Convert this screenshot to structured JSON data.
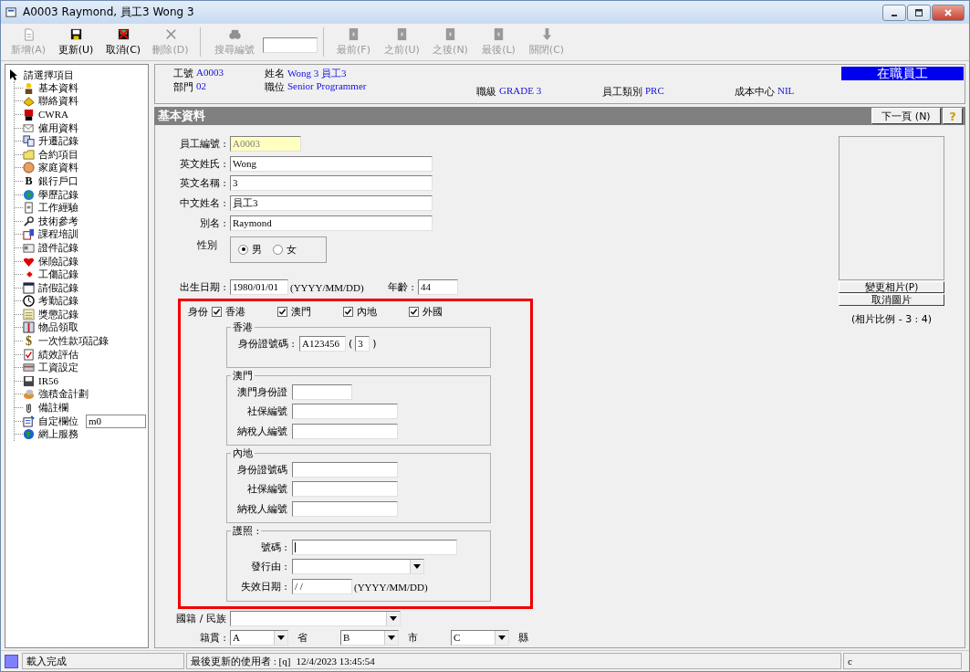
{
  "window": {
    "title": "A0003 Raymond, 員工3 Wong 3"
  },
  "toolbar": [
    {
      "label": "新增(A)",
      "kind": "new",
      "disabled": true
    },
    {
      "label": "更新(U)",
      "kind": "save",
      "disabled": false
    },
    {
      "label": "取消(C)",
      "kind": "cancel",
      "disabled": false
    },
    {
      "label": "刪除(D)",
      "kind": "delete",
      "disabled": true
    },
    {
      "label": "搜尋編號",
      "kind": "search",
      "disabled": true
    },
    {
      "label": "最前(F)",
      "kind": "nav",
      "disabled": true
    },
    {
      "label": "之前(U)",
      "kind": "nav",
      "disabled": true
    },
    {
      "label": "之後(N)",
      "kind": "nav",
      "disabled": true
    },
    {
      "label": "最後(L)",
      "kind": "nav",
      "disabled": true
    },
    {
      "label": "關閉(C)",
      "kind": "close",
      "disabled": true
    }
  ],
  "tree": {
    "root": "請選擇項目",
    "items": [
      {
        "label": "基本資料"
      },
      {
        "label": "聯絡資料"
      },
      {
        "label": "CWRA"
      },
      {
        "label": "僱用資料"
      },
      {
        "label": "升遷記錄"
      },
      {
        "label": "合約項目"
      },
      {
        "label": "家庭資料"
      },
      {
        "label": "銀行戶口",
        "icon_text": "B"
      },
      {
        "label": "學歷記錄"
      },
      {
        "label": "工作經驗"
      },
      {
        "label": "技術參考"
      },
      {
        "label": "課程培訓"
      },
      {
        "label": "證件記錄"
      },
      {
        "label": "保險記錄"
      },
      {
        "label": "工傷記錄"
      },
      {
        "label": "請假記錄"
      },
      {
        "label": "考勤記錄"
      },
      {
        "label": "獎懲記錄"
      },
      {
        "label": "物品領取"
      },
      {
        "label": "一次性款項記錄",
        "icon_text": "$"
      },
      {
        "label": "績效評估"
      },
      {
        "label": "工資設定"
      },
      {
        "label": "IR56"
      },
      {
        "label": "強積金計劃"
      },
      {
        "label": "備註欄"
      },
      {
        "label": "自定欄位",
        "field": "m0"
      },
      {
        "label": "網上服務"
      }
    ]
  },
  "header": {
    "rows": [
      [
        {
          "label": "工號",
          "value": "A0003"
        },
        {
          "label": "姓名",
          "value": "Wong 3 員工3"
        }
      ],
      [
        {
          "label": "部門",
          "value": "02"
        },
        {
          "label": "職位",
          "value": "Senior Programmer"
        },
        {
          "label": "職級",
          "value": "GRADE 3"
        },
        {
          "label": "員工類別",
          "value": "PRC"
        },
        {
          "label": "成本中心",
          "value": "NIL"
        }
      ]
    ],
    "status": "在職員工"
  },
  "section": {
    "title": "基本資料",
    "next": "下一頁 (N)",
    "help": "?"
  },
  "form": {
    "fields": [
      {
        "label": "員工編號 :",
        "value": "A0003",
        "kind": "readonly"
      },
      {
        "label": "英文姓氏 :",
        "value": "Wong",
        "kind": "text"
      },
      {
        "label": "英文名稱 :",
        "value": "3",
        "kind": "text"
      },
      {
        "label": "中文姓名 :",
        "value": "員工3",
        "kind": "text"
      },
      {
        "label": "別名 :",
        "value": "Raymond",
        "kind": "text"
      }
    ],
    "gender": {
      "label": "性別",
      "options": [
        {
          "label": "男",
          "selected": true
        },
        {
          "label": "女",
          "selected": false
        }
      ]
    },
    "birth": {
      "label": "出生日期 :",
      "value": "1980/01/01",
      "hint": "(YYYY/MM/DD)",
      "age_label": "年齡 :",
      "age": "44"
    },
    "highlighted": true,
    "identity": {
      "label": "身份",
      "options": [
        {
          "label": "香港",
          "checked": true
        },
        {
          "label": "澳門",
          "checked": true
        },
        {
          "label": "內地",
          "checked": true
        },
        {
          "label": "外國",
          "checked": true
        }
      ]
    },
    "groups": [
      {
        "title": "香港",
        "rows": [
          {
            "label": "身份證號碼 :",
            "kind": "hkid",
            "value": "A123456",
            "check": "3",
            "brackets": [
              "(",
              ")"
            ]
          }
        ]
      },
      {
        "title": "澳門",
        "rows": [
          {
            "label": "澳門身份證",
            "kind": "short"
          },
          {
            "label": "社保編號",
            "kind": "text"
          },
          {
            "label": "納稅人編號",
            "kind": "text"
          }
        ]
      },
      {
        "title": "內地",
        "rows": [
          {
            "label": "身份證號碼",
            "kind": "text"
          },
          {
            "label": "社保編號",
            "kind": "text"
          },
          {
            "label": "納稅人編號",
            "kind": "text"
          }
        ]
      },
      {
        "title": "護照 :",
        "rows": [
          {
            "label": "號碼 :",
            "kind": "long"
          },
          {
            "label": "發行由 :",
            "kind": "select"
          },
          {
            "label": "失效日期 :",
            "kind": "date",
            "value": "/ /",
            "hint": "(YYYY/MM/DD)"
          }
        ]
      }
    ],
    "nationality": {
      "label": "國籍 / 民族"
    },
    "origin": {
      "label": "籍貫 :",
      "items": [
        {
          "value": "A",
          "unit": "省"
        },
        {
          "value": "B",
          "unit": "市"
        },
        {
          "value": "C",
          "unit": "縣"
        }
      ]
    }
  },
  "photo": {
    "buttons": [
      "變更相片(P)",
      "取消圖片"
    ],
    "caption": "(相片比例 - 3 : 4)"
  },
  "status_bar": {
    "message": "載入完成",
    "last_user": "最後更新的使用者 : [q]",
    "time": "12/4/2023 13:45:54",
    "field": "c"
  }
}
